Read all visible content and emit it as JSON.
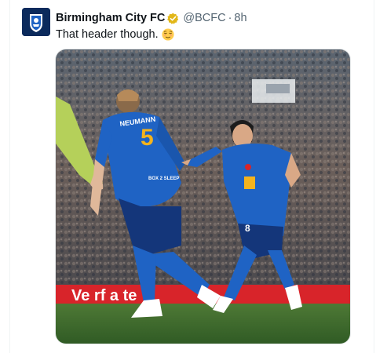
{
  "tweet": {
    "display_name": "Birmingham City FC",
    "handle": "@BCFC",
    "separator": "·",
    "timestamp": "8h",
    "text": "That header though.",
    "text_emoji": "relieved-face-emoji",
    "verified_icon": "verified-badge-icon",
    "avatar_icon": "birmingham-city-crest-icon"
  },
  "media": {
    "shirt_number_front": "5",
    "player_name_back": "NEUMANN",
    "shorts_number": "8",
    "board_text": "Ve  rf  a  te",
    "sponsor_text": "BOX 2 SLEEP"
  },
  "colors": {
    "club_blue": "#1f63c4",
    "navy": "#0b2a5c",
    "gold": "#f4b31d",
    "board_red": "#d8242a",
    "pitch_green": "#3f6c2e"
  }
}
